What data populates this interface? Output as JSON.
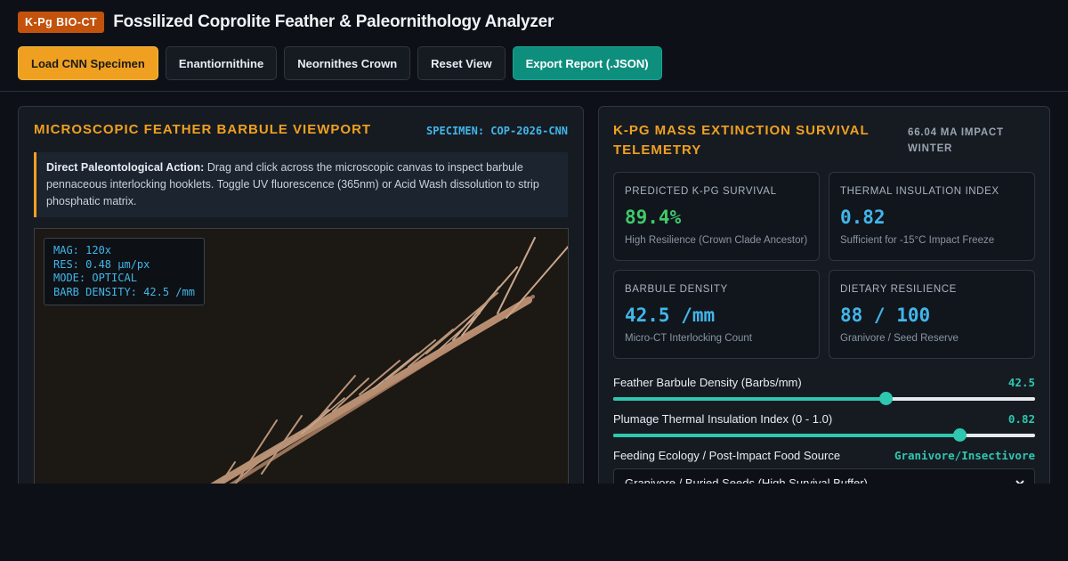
{
  "header": {
    "badge": "K-Pg BIO-CT",
    "title": "Fossilized Coprolite Feather & Paleornithology Analyzer"
  },
  "toolbar": {
    "load": "Load CNN Specimen",
    "enantiornithine": "Enantiornithine",
    "neornithes": "Neornithes Crown",
    "reset": "Reset View",
    "export": "Export Report (.JSON)"
  },
  "viewport_panel": {
    "heading": "MICROSCOPIC FEATHER BARBULE VIEWPORT",
    "specimen": "SPECIMEN: COP-2026-CNN",
    "note_bold": "Direct Paleontological Action:",
    "note_text": " Drag and click across the microscopic canvas to inspect barbule pennaceous interlocking hooklets. Toggle UV fluorescence (365nm) or Acid Wash dissolution to strip phosphatic matrix.",
    "readout": {
      "mag": "MAG: 120x",
      "res": "RES: 0.48 µm/px",
      "mode": "MODE: OPTICAL",
      "density": "BARB DENSITY: 42.5 /mm"
    }
  },
  "telemetry_panel": {
    "heading": "K-PG MASS EXTINCTION SURVIVAL TELEMETRY",
    "impact": "66.04 MA IMPACT WINTER",
    "cards": [
      {
        "label": "PREDICTED K-PG SURVIVAL",
        "value": "89.4%",
        "sub": "High Resilience (Crown Clade Ancestor)",
        "color": "#3fca6b"
      },
      {
        "label": "THERMAL INSULATION INDEX",
        "value": "0.82",
        "sub": "Sufficient for -15°C Impact Freeze",
        "color": "#42b6ea"
      },
      {
        "label": "BARBULE DENSITY",
        "value": "42.5 /mm",
        "sub": "Micro-CT Interlocking Count",
        "color": "#42b6ea"
      },
      {
        "label": "DIETARY RESILIENCE",
        "value": "88 / 100",
        "sub": "Granivore / Seed Reserve",
        "color": "#42b6ea"
      }
    ],
    "sliders": [
      {
        "label": "Feather Barbule Density (Barbs/mm)",
        "value": "42.5",
        "fraction": 0.645
      },
      {
        "label": "Plumage Thermal Insulation Index (0 - 1.0)",
        "value": "0.82",
        "fraction": 0.82
      }
    ],
    "feeding": {
      "label": "Feeding Ecology / Post-Impact Food Source",
      "value": "Granivore/Insectivore",
      "selected": "Granivore / Buried Seeds (High Survival Buffer)"
    }
  }
}
